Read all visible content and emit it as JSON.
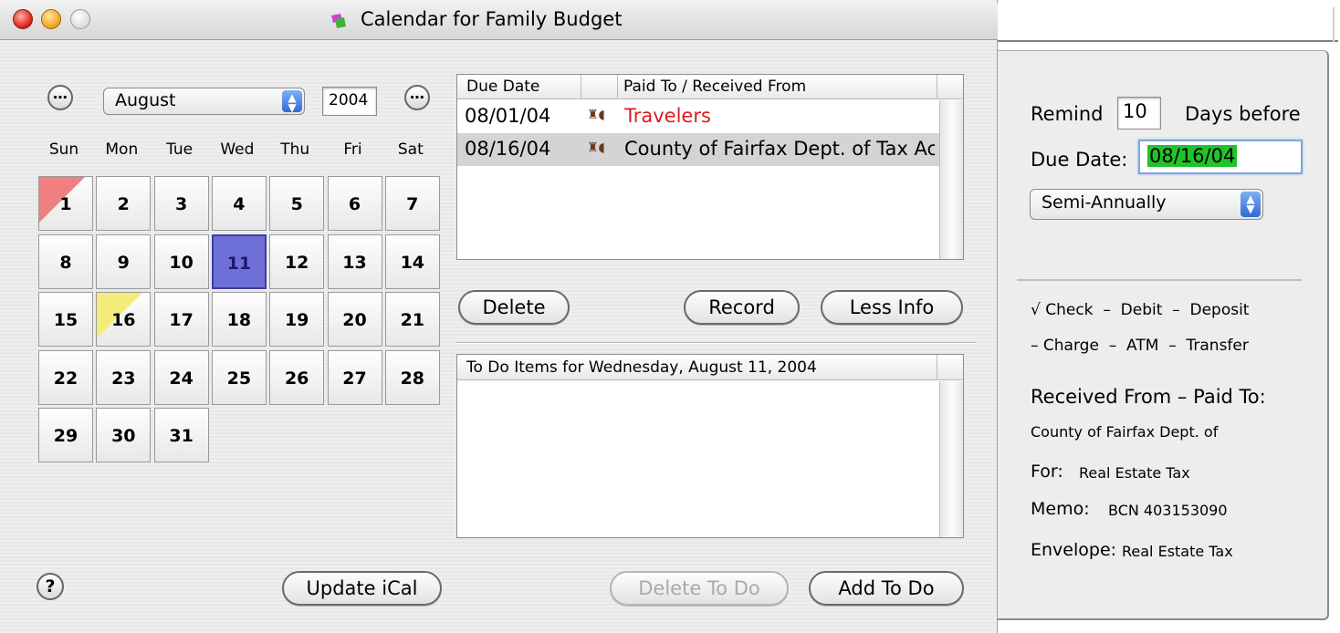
{
  "window": {
    "title": "Calendar for Family Budget"
  },
  "calendar": {
    "month": "August",
    "year": "2004",
    "weekdays": [
      "Sun",
      "Mon",
      "Tue",
      "Wed",
      "Thu",
      "Fri",
      "Sat"
    ],
    "selected_day": "11",
    "due_days": [
      "1",
      "16"
    ]
  },
  "due_table": {
    "col_due_date": "Due Date",
    "col_paid_to": "Paid To / Received From",
    "rows": [
      {
        "date": "08/01/04",
        "name": "Travelers",
        "color": "#e0191e"
      },
      {
        "date": "08/16/04",
        "name": "County of Fairfax Dept. of Tax Ac",
        "color": "#000000"
      }
    ]
  },
  "buttons": {
    "delete": "Delete",
    "record": "Record",
    "less_info": "Less Info",
    "update_ical": "Update iCal",
    "delete_todo": "Delete To Do",
    "add_todo": "Add To Do",
    "help": "?"
  },
  "todo": {
    "header": "To Do Items for Wednesday, August 11, 2004"
  },
  "drawer": {
    "remind_label": "Remind",
    "remind_days": "10",
    "days_before_label": "Days before",
    "due_date_label": "Due Date:",
    "due_date_value": "08/16/04",
    "frequency": "Semi-Annually",
    "type_line1": "√ Check  –  Debit  –  Deposit",
    "type_line2": "– Charge  –  ATM  –  Transfer",
    "received_label": "Received From – Paid To:",
    "received_value": "County of Fairfax Dept. of",
    "for_label": "For:",
    "for_value": "Real Estate Tax",
    "memo_label": "Memo:",
    "memo_value": "BCN 403153090",
    "envelope_label": "Envelope:",
    "envelope_value": "Real Estate Tax"
  },
  "colors": {
    "selected_day": "#6f6fd8",
    "due_day_1": "#f08080",
    "due_day_16": "#f4ec7a",
    "due_date_highlight": "#22c22a"
  }
}
